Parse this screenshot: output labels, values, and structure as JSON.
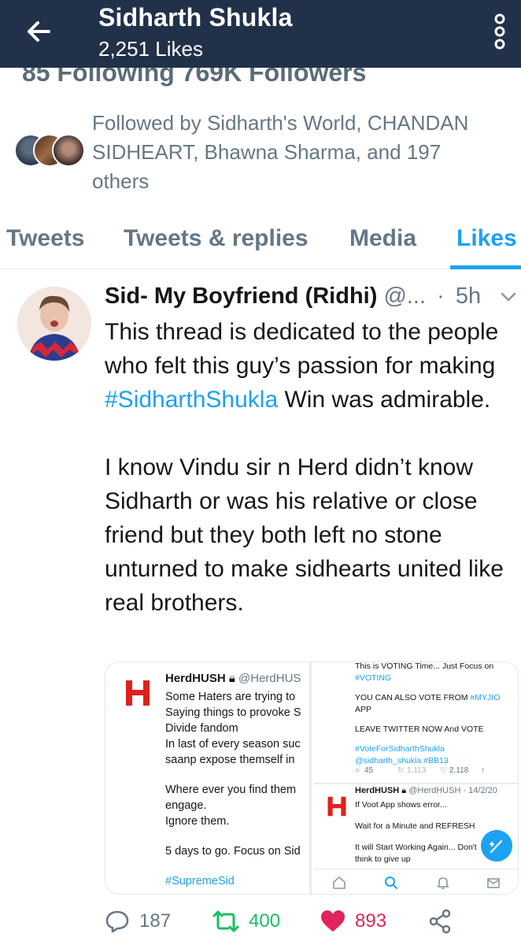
{
  "header": {
    "title": "Sidharth Shukla",
    "subtitle": "2,251 Likes",
    "cutoff_text": "85 Following   769K Followers",
    "colors": {
      "bar": "#22314a"
    }
  },
  "followed_by": {
    "text": "Followed by Sidharth's World, CHANDAN SIDHEART, Bhawna Sharma, and 197 others"
  },
  "tabs": [
    {
      "label": "Tweets"
    },
    {
      "label": "Tweets & replies"
    },
    {
      "label": "Media"
    },
    {
      "label": "Likes"
    }
  ],
  "tweet": {
    "name": "Sid- My Boyfriend (Ridhi)",
    "handle": "@...",
    "dot": "·",
    "time": "5h",
    "body_1a": "This thread is dedicated to the people who felt this guy’s passion for making ",
    "hashtag": "#SidharthShukla",
    "body_1b": "  Win was admirable.",
    "body_2": "I know Vindu sir n Herd didn’t know Sidharth or was his relative or close friend but they both left no stone unturned to make sidhearts united like real brothers.",
    "stats": {
      "replies": "187",
      "retweets": "400",
      "likes": "893"
    }
  },
  "media_left": {
    "name": "HerdHUSH",
    "handle": "@HerdHUS",
    "lines_1": [
      "Some Haters are trying to",
      "Saying things to provoke S",
      "Divide fandom",
      "In last of every season suc",
      "saanp expose themself in"
    ],
    "lines_2": [
      "Where ever you find them",
      "engage.",
      "Ignore them."
    ],
    "line_3": "5 days to go. Focus on Sid",
    "hashtag": "#SupremeSid"
  },
  "media_right": {
    "line_1": "This is VOTING Time... Just Focus on",
    "line_2": "#VOTING",
    "line_3a": "YOU CAN ALSO VOTE FROM ",
    "line_3b": "#MYJIO",
    "line_3c": "APP",
    "line_4": "LEAVE TWITTER NOW And VOTE",
    "line_5": "#VoteForSidharthShukla",
    "line_6": "@sidharth_shukla #BB13",
    "counts": {
      "replies": "45",
      "retweets": "1,113",
      "likes": "2,118"
    },
    "name": "HerdHUSH",
    "handle": "@HerdHUSH · 14/2/20",
    "t1": "If Voot App shows error...",
    "t2": "Wait for a Minute and REFRESH",
    "t3": "It will Start Working Again... Don't",
    "t4": "think to give up"
  }
}
